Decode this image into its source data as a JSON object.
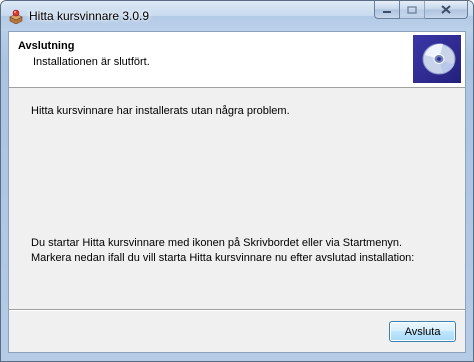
{
  "window": {
    "title": "Hitta kursvinnare 3.0.9",
    "app_icon": "installer-box-icon",
    "caption_buttons": [
      {
        "name": "minimize",
        "icon": "minimize-icon"
      },
      {
        "name": "maximize",
        "icon": "maximize-icon",
        "disabled": true
      },
      {
        "name": "close",
        "icon": "close-icon"
      }
    ]
  },
  "header": {
    "title": "Avslutning",
    "subtitle": "Installationen är slutfört.",
    "image_icon": "cd-disc-icon"
  },
  "content": {
    "message": "Hitta kursvinnare har installerats utan några problem.",
    "info_line1": "Du startar Hitta kursvinnare med ikonen på Skrivbordet eller via Startmenyn.",
    "info_line2": "Markera nedan ifall du vill starta Hitta kursvinnare nu efter avslutad installation:"
  },
  "buttons": {
    "finish_label": "Avsluta"
  },
  "colors": {
    "accent_header_image": "#2e2a8e",
    "dialog_background": "#f0f0f0",
    "button_border": "#3c7fb1"
  }
}
